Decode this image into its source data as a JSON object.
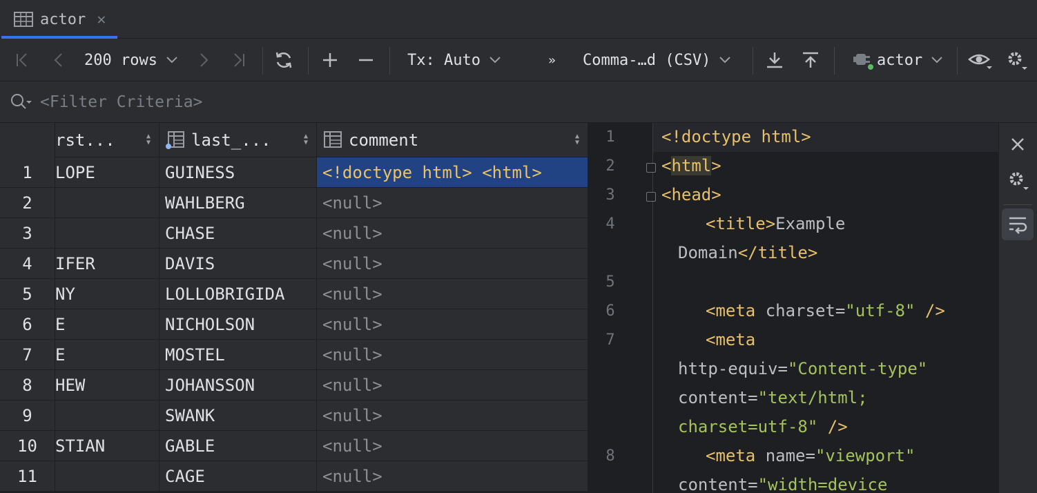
{
  "tab": {
    "label": "actor",
    "close": "✕"
  },
  "toolbar": {
    "rows_label": "200 rows",
    "tx_label": "Tx: Auto",
    "more": "»",
    "format_label": "Comma-…d (CSV)",
    "datasource_label": "actor"
  },
  "filter": {
    "placeholder": "<Filter Criteria>"
  },
  "grid": {
    "columns": [
      {
        "name": "rst..."
      },
      {
        "name": "last_..."
      },
      {
        "name": "comment"
      }
    ],
    "rows": [
      {
        "num": "1",
        "first": "LOPE",
        "last": "GUINESS",
        "comment": "<!doctype html> <html>"
      },
      {
        "num": "2",
        "first": "",
        "last": "WAHLBERG",
        "comment": "<null>"
      },
      {
        "num": "3",
        "first": "",
        "last": "CHASE",
        "comment": "<null>"
      },
      {
        "num": "4",
        "first": "IFER",
        "last": "DAVIS",
        "comment": "<null>"
      },
      {
        "num": "5",
        "first": "NY",
        "last": "LOLLOBRIGIDA",
        "comment": "<null>"
      },
      {
        "num": "6",
        "first": "E",
        "last": "NICHOLSON",
        "comment": "<null>"
      },
      {
        "num": "7",
        "first": "E",
        "last": "MOSTEL",
        "comment": "<null>"
      },
      {
        "num": "8",
        "first": "HEW",
        "last": "JOHANSSON",
        "comment": "<null>"
      },
      {
        "num": "9",
        "first": "",
        "last": "SWANK",
        "comment": "<null>"
      },
      {
        "num": "10",
        "first": "STIAN",
        "last": "GABLE",
        "comment": "<null>"
      },
      {
        "num": "11",
        "first": "",
        "last": "CAGE",
        "comment": "<null>"
      }
    ]
  },
  "editor": {
    "line_numbers": [
      "1",
      "2",
      "3",
      "4",
      "5",
      "6",
      "7",
      "8"
    ],
    "l1_tag": "<!doctype",
    "l1_rest": " html>",
    "l2_open": "<",
    "l2_name": "html",
    "l2_close": ">",
    "l3": "<head>",
    "l4_open": "<title>",
    "l4_text": "Example",
    "l4b_text": "Domain",
    "l4b_close": "</title>",
    "l6_tag": "<meta",
    "l6_attr": " charset=",
    "l6_str": "\"utf-8\"",
    "l6_end": " />",
    "l7_tag": "<meta",
    "l7b_attr": "http-equiv=",
    "l7b_str": "\"Content-type\"",
    "l7c_attr": "content=",
    "l7c_str": "\"text/html;",
    "l7d_str": "charset=utf-8\"",
    "l7d_end": " />",
    "l8_tag": "<meta",
    "l8_attr": " name=",
    "l8_str": "\"viewport\"",
    "l8b_attr": "content=",
    "l8b_str": "\"width=device"
  }
}
